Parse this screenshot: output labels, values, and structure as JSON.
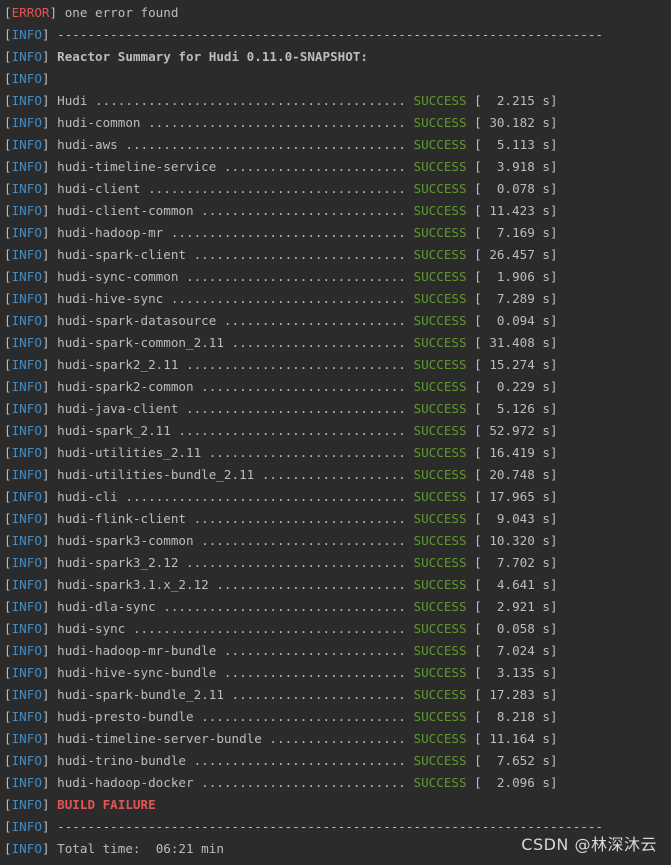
{
  "error_line": {
    "level": "ERROR",
    "text": "one error found"
  },
  "separator": "------------------------------------------------------------------------",
  "summary_title": "Reactor Summary for Hudi 0.11.0-SNAPSHOT:",
  "info_level": "INFO",
  "status_success": "SUCCESS",
  "modules": [
    {
      "name": "Hudi",
      "time": "2.215"
    },
    {
      "name": "hudi-common",
      "time": "30.182"
    },
    {
      "name": "hudi-aws",
      "time": "5.113"
    },
    {
      "name": "hudi-timeline-service",
      "time": "3.918"
    },
    {
      "name": "hudi-client",
      "time": "0.078"
    },
    {
      "name": "hudi-client-common",
      "time": "11.423"
    },
    {
      "name": "hudi-hadoop-mr",
      "time": "7.169"
    },
    {
      "name": "hudi-spark-client",
      "time": "26.457"
    },
    {
      "name": "hudi-sync-common",
      "time": "1.906"
    },
    {
      "name": "hudi-hive-sync",
      "time": "7.289"
    },
    {
      "name": "hudi-spark-datasource",
      "time": "0.094"
    },
    {
      "name": "hudi-spark-common_2.11",
      "time": "31.408"
    },
    {
      "name": "hudi-spark2_2.11",
      "time": "15.274"
    },
    {
      "name": "hudi-spark2-common",
      "time": "0.229"
    },
    {
      "name": "hudi-java-client",
      "time": "5.126"
    },
    {
      "name": "hudi-spark_2.11",
      "time": "52.972"
    },
    {
      "name": "hudi-utilities_2.11",
      "time": "16.419"
    },
    {
      "name": "hudi-utilities-bundle_2.11",
      "time": "20.748"
    },
    {
      "name": "hudi-cli",
      "time": "17.965"
    },
    {
      "name": "hudi-flink-client",
      "time": "9.043"
    },
    {
      "name": "hudi-spark3-common",
      "time": "10.320"
    },
    {
      "name": "hudi-spark3_2.12",
      "time": "7.702"
    },
    {
      "name": "hudi-spark3.1.x_2.12",
      "time": "4.641"
    },
    {
      "name": "hudi-dla-sync",
      "time": "2.921"
    },
    {
      "name": "hudi-sync",
      "time": "0.058"
    },
    {
      "name": "hudi-hadoop-mr-bundle",
      "time": "7.024"
    },
    {
      "name": "hudi-hive-sync-bundle",
      "time": "3.135"
    },
    {
      "name": "hudi-spark-bundle_2.11",
      "time": "17.283"
    },
    {
      "name": "hudi-presto-bundle",
      "time": "8.218"
    },
    {
      "name": "hudi-timeline-server-bundle",
      "time": "11.164"
    },
    {
      "name": "hudi-trino-bundle",
      "time": "7.652"
    },
    {
      "name": "hudi-hadoop-docker",
      "time": "2.096"
    }
  ],
  "build_result": "BUILD FAILURE",
  "total_time": {
    "label": "Total time:",
    "value": "06:21 min"
  },
  "watermark": "CSDN @林深沐云",
  "colors": {
    "background": "#2b2b2b",
    "info": "#3d8ec9",
    "error": "#e05555",
    "success": "#5e9a2c",
    "text": "#b9bcc0"
  }
}
